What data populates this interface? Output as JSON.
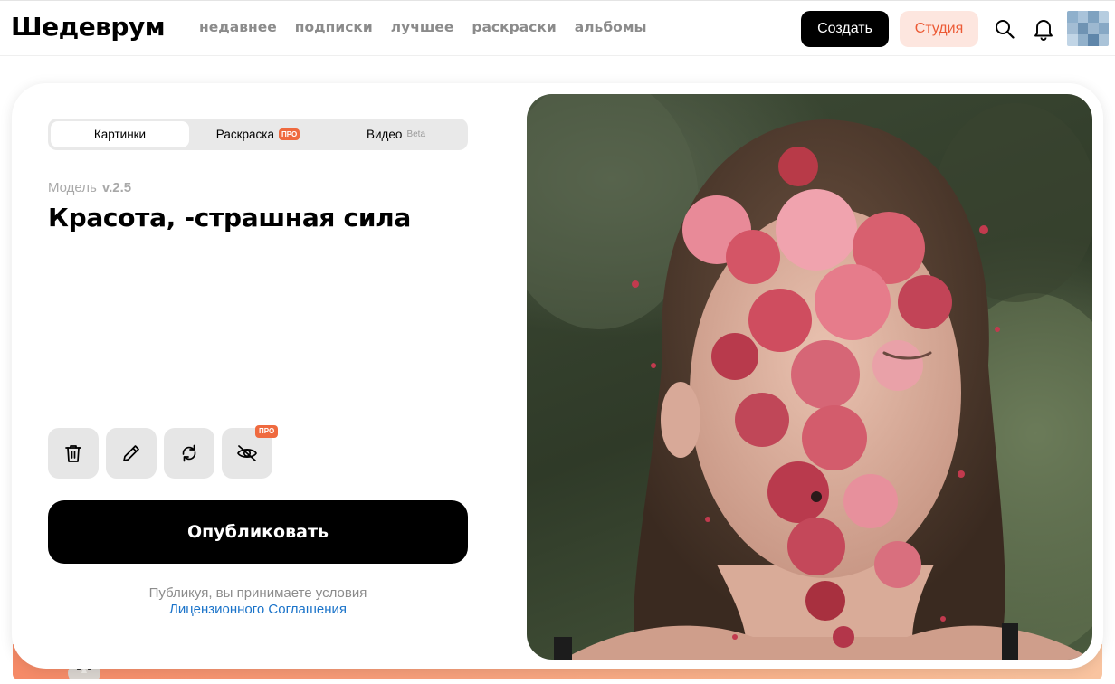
{
  "header": {
    "logo": "Шедеврум",
    "nav": [
      "недавнее",
      "подписки",
      "лучшее",
      "раскраски",
      "альбомы"
    ],
    "create_label": "Создать",
    "studio_label": "Студия",
    "icons": [
      "search-icon",
      "bell-icon"
    ]
  },
  "tabs": [
    {
      "label": "Картинки",
      "active": true
    },
    {
      "label": "Раскраска",
      "badge": "ПРО"
    },
    {
      "label": "Видео",
      "badge": "Beta"
    }
  ],
  "model": {
    "label": "Модель",
    "version": "v.2.5"
  },
  "prompt": "Красота, -страшная сила",
  "tools": {
    "icons": [
      "trash-icon",
      "pencil-icon",
      "refresh-icon",
      "eye-off-icon"
    ],
    "pro_badge": "ПРО"
  },
  "publish_label": "Опубликовать",
  "terms": {
    "text": "Публикуя, вы принимаете условия",
    "link": "Лицензионного Соглашения"
  },
  "colors": {
    "accent": "#ef6a3f",
    "studio_bg": "#fde6df",
    "studio_text": "#ec5a35",
    "link": "#1a73c9"
  }
}
